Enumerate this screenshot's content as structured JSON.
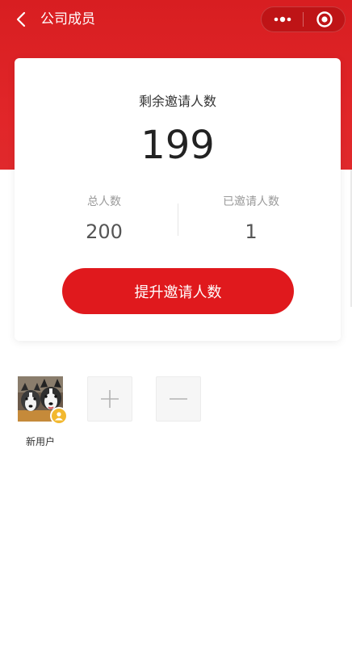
{
  "nav": {
    "title": "公司成员",
    "back_icon": "chevron-left-icon",
    "more_icon": "more-dots-icon",
    "close_icon": "target-circle-icon"
  },
  "stats": {
    "remaining_label": "剩余邀请人数",
    "remaining_value": "199",
    "total_label": "总人数",
    "total_value": "200",
    "invited_label": "已邀请人数",
    "invited_value": "1",
    "upgrade_button": "提升邀请人数"
  },
  "members": {
    "items": [
      {
        "name": "新用户",
        "avatar": "husky-dogs-photo",
        "badge_icon": "user-badge-icon"
      }
    ],
    "add_icon": "plus-icon",
    "remove_icon": "minus-icon"
  },
  "colors": {
    "brand_red": "#e0191d",
    "header_red": "#d81e21",
    "badge_yellow": "#f2b82f"
  }
}
